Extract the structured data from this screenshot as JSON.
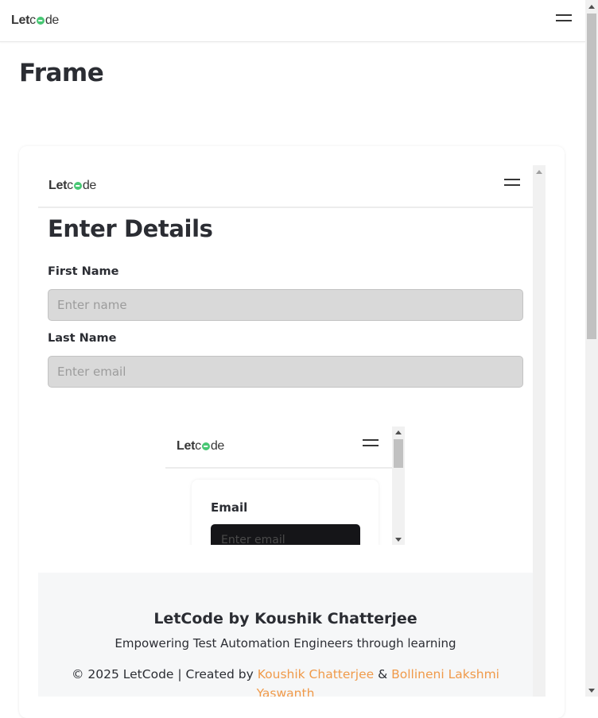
{
  "header": {
    "logo": {
      "part1": "Let",
      "part2": "c",
      "part3": "de"
    },
    "menu_icon": "hamburger-menu-icon"
  },
  "page": {
    "title": "Frame"
  },
  "frame": {
    "logo": {
      "part1": "Let",
      "part2": "c",
      "part3": "de"
    },
    "heading": "Enter Details",
    "first_name": {
      "label": "First Name",
      "placeholder": "Enter name",
      "value": ""
    },
    "last_name": {
      "label": "Last Name",
      "placeholder": "Enter email",
      "value": ""
    },
    "inner_frame": {
      "logo": {
        "part1": "Let",
        "part2": "c",
        "part3": "de"
      },
      "email": {
        "label": "Email",
        "placeholder": "Enter email",
        "value": ""
      }
    },
    "footer": {
      "title": "LetCode by Koushik Chatterjee",
      "tagline": "Empowering Test Automation Engineers through learning",
      "credits_prefix": "© 2025 LetCode | Created by",
      "author1": "Koushik Chatterjee",
      "separator": "&",
      "author2": "Bollineni Lakshmi Yaswanth"
    }
  },
  "colors": {
    "logo_accent": "#48c774",
    "link": "#f09a4a",
    "input_bg": "#d9d9d9",
    "dark_input_bg": "#151518",
    "footer_bg": "#f6f7f8"
  }
}
